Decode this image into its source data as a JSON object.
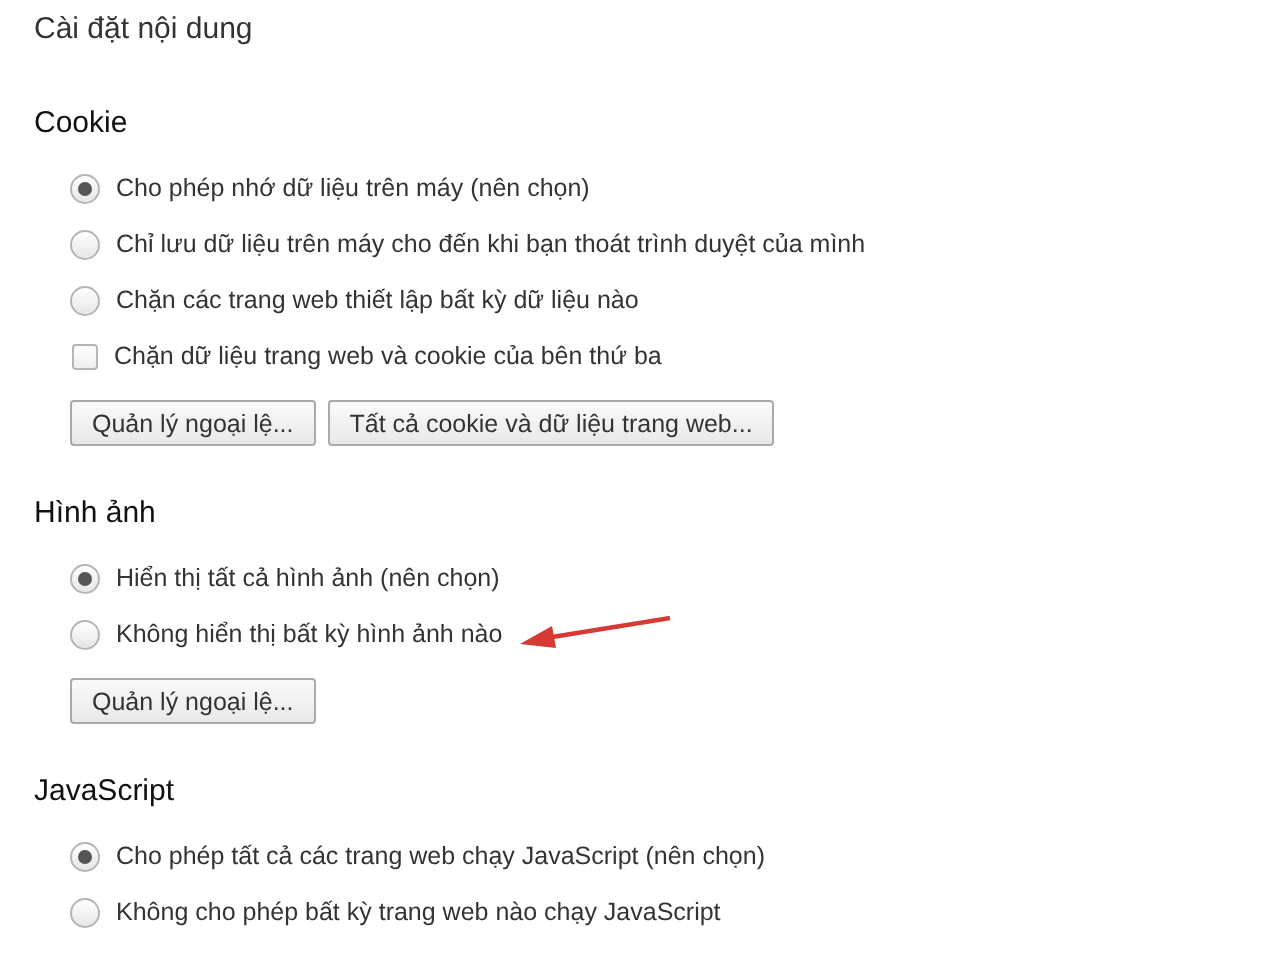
{
  "title": "Cài đặt nội dung",
  "sections": [
    {
      "heading": "Cookie",
      "options": [
        {
          "kind": "radio",
          "label": "Cho phép nhớ dữ liệu trên máy (nên chọn)",
          "checked": true,
          "marked": false
        },
        {
          "kind": "radio",
          "label": "Chỉ lưu dữ liệu trên máy cho đến khi bạn thoát trình duyệt của mình",
          "checked": false,
          "marked": false
        },
        {
          "kind": "radio",
          "label": "Chặn các trang web thiết lập bất kỳ dữ liệu nào",
          "checked": false,
          "marked": false
        },
        {
          "kind": "checkbox",
          "label": "Chặn dữ liệu trang web và cookie của bên thứ ba",
          "checked": false,
          "marked": false
        }
      ],
      "buttons": [
        "Quản lý ngoại lệ...",
        "Tất cả cookie và dữ liệu trang web..."
      ]
    },
    {
      "heading": "Hình ảnh",
      "options": [
        {
          "kind": "radio",
          "label": "Hiển thị tất cả hình ảnh (nên chọn)",
          "checked": true,
          "marked": false
        },
        {
          "kind": "radio",
          "label": "Không hiển thị bất kỳ hình ảnh nào",
          "checked": false,
          "marked": true
        }
      ],
      "buttons": [
        "Quản lý ngoại lệ..."
      ]
    },
    {
      "heading": "JavaScript",
      "options": [
        {
          "kind": "radio",
          "label": "Cho phép tất cả các trang web chạy JavaScript (nên chọn)",
          "checked": true,
          "marked": false
        },
        {
          "kind": "radio",
          "label": "Không cho phép bất kỳ trang web nào chạy JavaScript",
          "checked": false,
          "marked": false
        }
      ]
    }
  ]
}
